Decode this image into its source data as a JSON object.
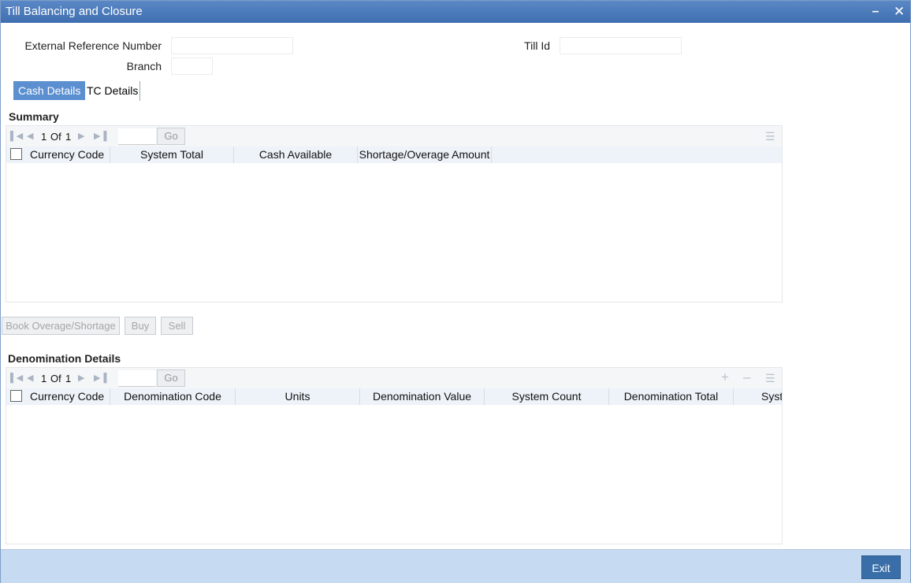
{
  "window": {
    "title": "Till Balancing and Closure"
  },
  "form": {
    "ext_ref_label": "External Reference Number",
    "ext_ref_value": "",
    "branch_label": "Branch",
    "branch_value": "",
    "till_id_label": "Till Id",
    "till_id_value": ""
  },
  "tabs": [
    {
      "label": "Cash Details",
      "active": true
    },
    {
      "label": "TC Details",
      "active": false
    }
  ],
  "summary": {
    "title": "Summary",
    "pager": {
      "current": "1",
      "of_label": "Of",
      "total": "1",
      "go_label": "Go"
    },
    "columns": [
      "Currency Code",
      "System Total",
      "Cash Available",
      "Shortage/Overage Amount"
    ],
    "rows": []
  },
  "actions": {
    "book_label": "Book Overage/Shortage",
    "buy_label": "Buy",
    "sell_label": "Sell"
  },
  "denomination": {
    "title": "Denomination Details",
    "pager": {
      "current": "1",
      "of_label": "Of",
      "total": "1",
      "go_label": "Go"
    },
    "columns": [
      "Currency Code",
      "Denomination Code",
      "Units",
      "Denomination Value",
      "System Count",
      "Denomination Total",
      "Syst"
    ],
    "rows": []
  },
  "footer": {
    "exit_label": "Exit"
  },
  "icons": {
    "first": "first-page-icon",
    "prev": "previous-page-icon",
    "next": "next-page-icon",
    "last": "last-page-icon",
    "columns": "column-settings-icon",
    "add": "add-row-icon",
    "delete": "delete-row-icon"
  },
  "colors": {
    "titlebar": "#4a7bbd",
    "active_tab": "#5b8fd0",
    "footer": "#c6dbf1",
    "exit_button": "#3a6ea8",
    "grid_header": "#eef3f9"
  }
}
